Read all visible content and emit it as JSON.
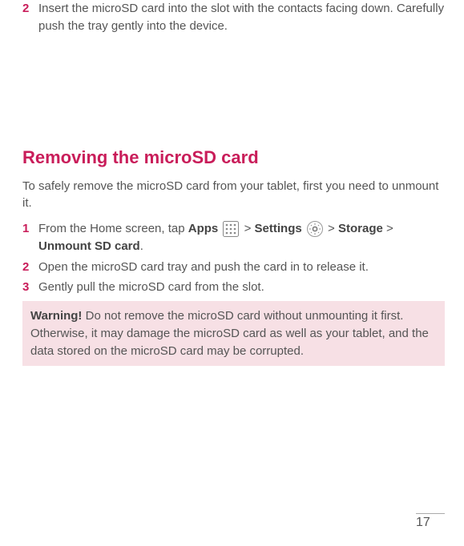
{
  "topStep": {
    "number": "2",
    "text": "Insert the microSD card into the slot with the contacts facing down. Carefully push the tray gently into the device."
  },
  "section": {
    "heading": "Removing the microSD card",
    "intro": "To safely remove the microSD card from your tablet, first you need to unmount it.",
    "steps": [
      {
        "number": "1",
        "prefix": "From the Home screen, tap ",
        "apps": "Apps",
        "sep1": " > ",
        "settings": "Settings",
        "sep2": " > ",
        "storage": "Storage",
        "sep3": " > ",
        "unmount": "Unmount SD card",
        "suffix": "."
      },
      {
        "number": "2",
        "text": "Open the microSD card tray and push the card in to release it."
      },
      {
        "number": "3",
        "text": "Gently pull the microSD card from the slot."
      }
    ],
    "warning": {
      "label": "Warning!",
      "text": " Do not remove the microSD card without unmounting it first. Otherwise, it may damage the microSD card as well as your tablet, and the data stored on the microSD card may be corrupted."
    }
  },
  "pageNumber": "17"
}
